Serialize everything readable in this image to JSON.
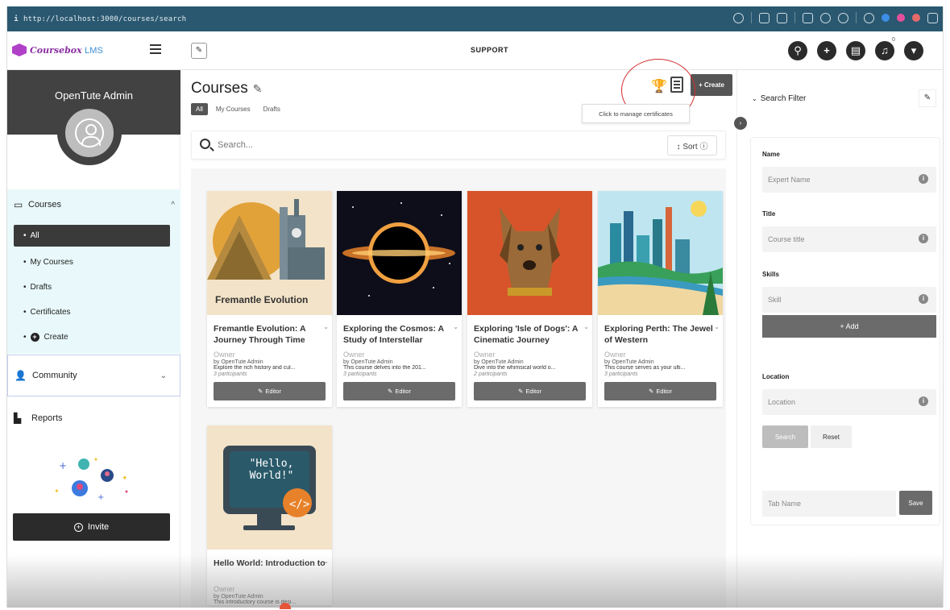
{
  "browser": {
    "info_glyph": "i",
    "url": "http://localhost:3000/courses/search"
  },
  "app": {
    "brand_name": "Coursebox",
    "brand_suffix": "LMS",
    "header_center": "SUPPORT",
    "notification_count": "0"
  },
  "sidebar": {
    "profile_name": "OpenTute Admin",
    "courses_label": "Courses",
    "items": [
      {
        "label": "All",
        "active": true
      },
      {
        "label": "My Courses"
      },
      {
        "label": "Drafts"
      },
      {
        "label": "Certificates"
      },
      {
        "label": "Create"
      }
    ],
    "community_label": "Community",
    "reports_label": "Reports",
    "invite_label": "Invite"
  },
  "main": {
    "title": "Courses",
    "tabs": [
      "All",
      "My Courses",
      "Drafts"
    ],
    "create_label": "+ Create",
    "tooltip": "Click to manage certificates",
    "search_placeholder": "Search...",
    "sort_label": "↕ Sort ⓘ",
    "cards": [
      {
        "title": "Fremantle Evolution: A Journey Through Time",
        "image_caption": "Fremantle Evolution",
        "owner": "Owner",
        "by": "by OpenTute Admin",
        "desc": "Explore the rich history and cul...",
        "participants": "3 participants",
        "editor": "Editor"
      },
      {
        "title": "Exploring the Cosmos: A Study of Interstellar",
        "owner": "Owner",
        "by": "by OpenTute Admin",
        "desc": "This course delves into the 201...",
        "participants": "3 participants",
        "editor": "Editor"
      },
      {
        "title": "Exploring 'Isle of Dogs': A Cinematic Journey",
        "owner": "Owner",
        "by": "by OpenTute Admin",
        "desc": "Dive into the whimsical world o...",
        "participants": "2 participants",
        "editor": "Editor"
      },
      {
        "title": "Exploring Perth: The Jewel of Western",
        "owner": "Owner",
        "by": "by OpenTute Admin",
        "desc": "This course serves as your ulti...",
        "participants": "3 participants",
        "editor": "Editor"
      },
      {
        "title": "Hello World: Introduction to",
        "image_caption": "\"Hello, World!\"",
        "owner": "Owner",
        "by": "by OpenTute Admin",
        "desc": "This introductory course is desi...",
        "participants": "",
        "editor": ""
      }
    ]
  },
  "filter": {
    "title": "Search Filter",
    "name_label": "Name",
    "name_placeholder": "Expert Name",
    "title_label": "Title",
    "title_placeholder": "Course title",
    "skills_label": "Skills",
    "skills_placeholder": "Skill",
    "add_label": "+ Add",
    "location_label": "Location",
    "location_placeholder": "Location",
    "search_label": "Search",
    "reset_label": "Reset",
    "tab_name_placeholder": "Tab Name",
    "save_label": "Save"
  }
}
